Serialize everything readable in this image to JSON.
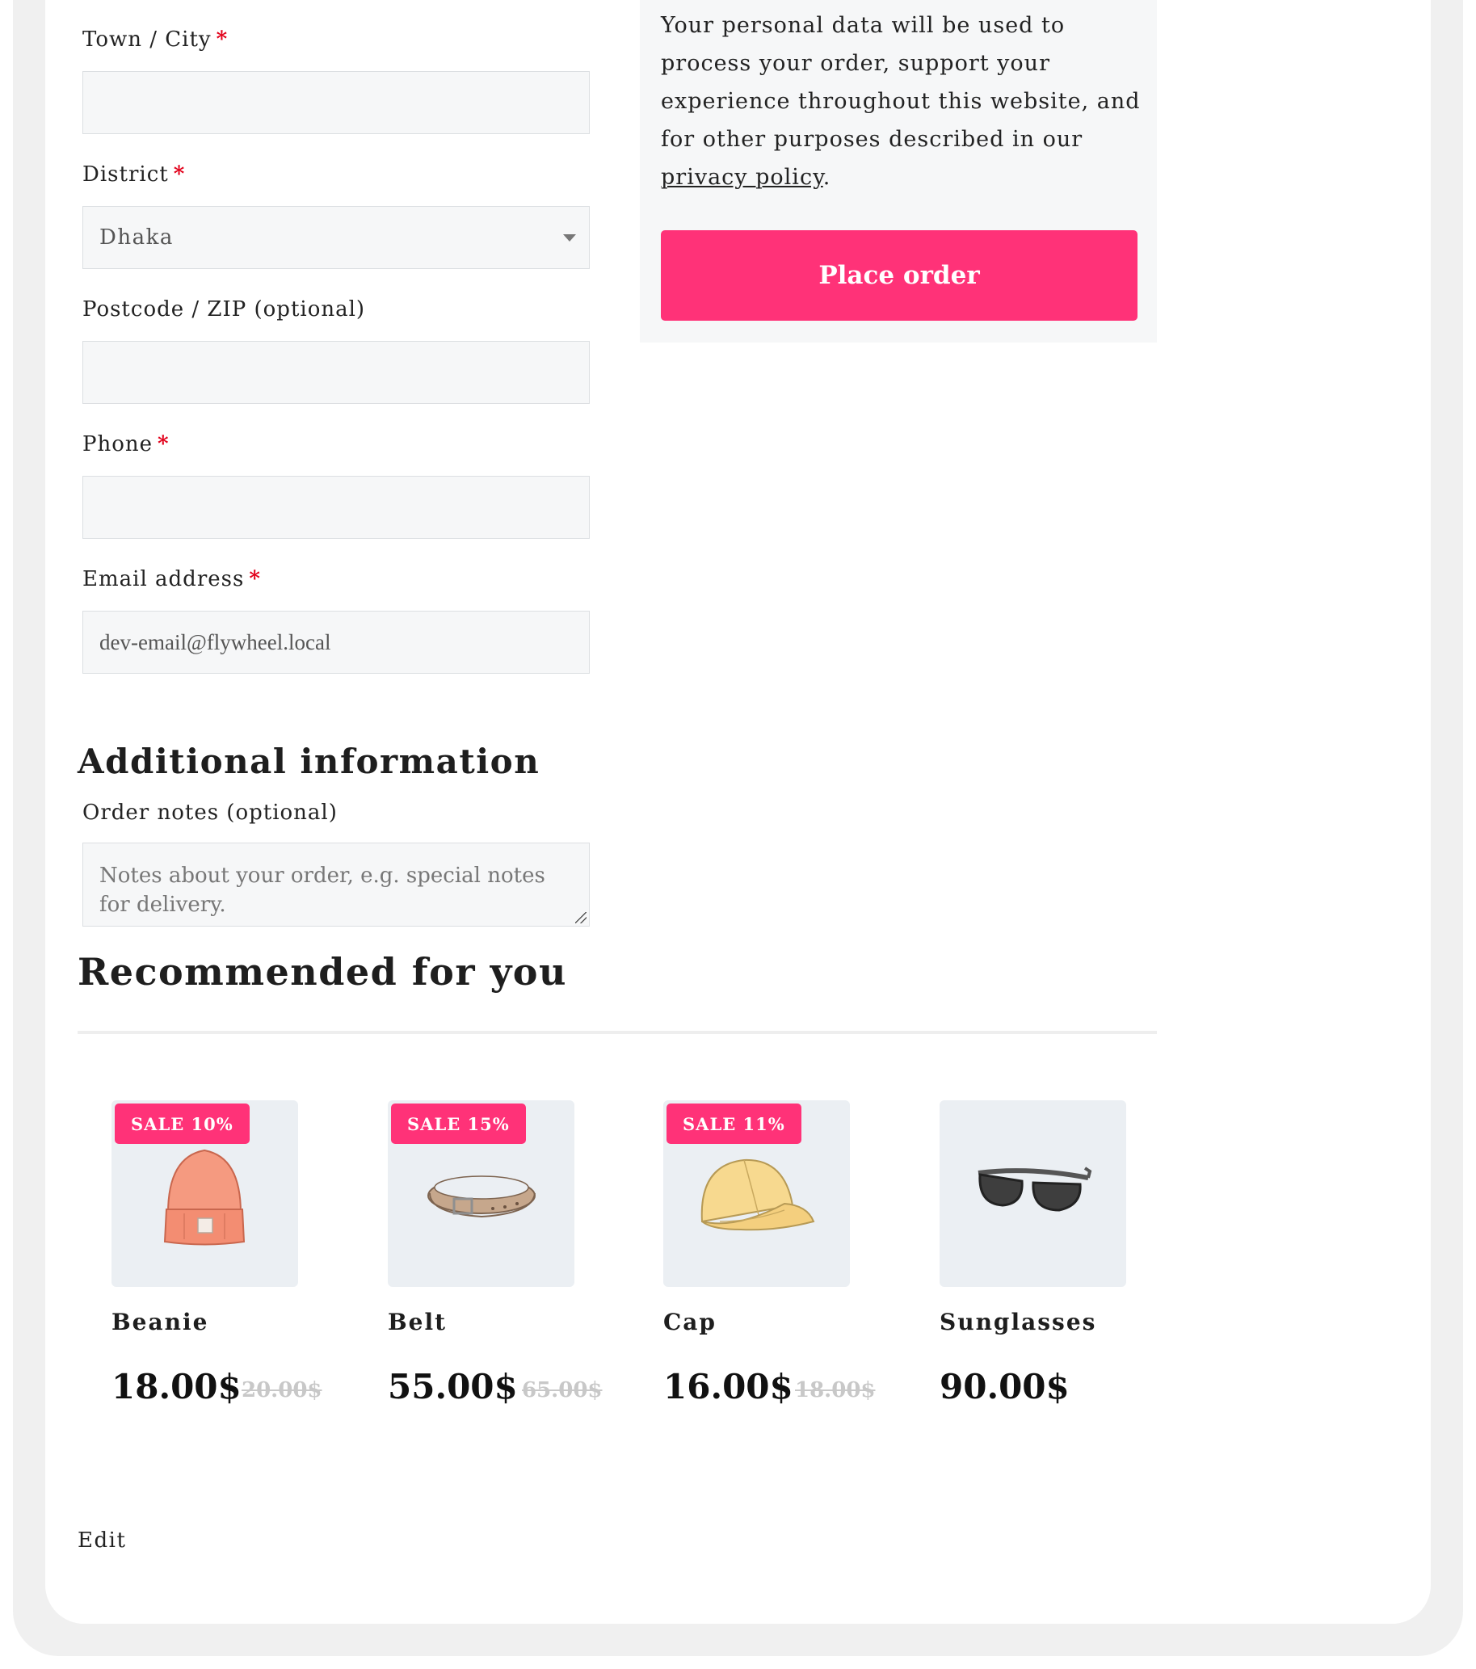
{
  "billing": {
    "town_label": "Town / City",
    "town_value": "",
    "district_label": "District",
    "district_value": "Dhaka",
    "postcode_label": "Postcode / ZIP (optional)",
    "postcode_value": "",
    "phone_label": "Phone",
    "phone_value": "",
    "email_label": "Email address",
    "email_value": "dev-email@flywheel.local",
    "required_mark": "*"
  },
  "order_review": {
    "privacy_text_before": "Your personal data will be used to process your order, support your experience throughout this website, and for other purposes described in our ",
    "privacy_link": "privacy policy",
    "privacy_text_after": ".",
    "place_order_label": "Place order"
  },
  "additional": {
    "heading": "Additional information",
    "notes_label": "Order notes (optional)",
    "notes_placeholder": "Notes about your order, e.g. special notes for delivery."
  },
  "recommended": {
    "heading": "Recommended for you",
    "products": [
      {
        "name": "Beanie",
        "price": "18.00$",
        "old_price": "20.00$",
        "badge": "SALE 10%",
        "icon": "beanie-icon"
      },
      {
        "name": "Belt",
        "price": "55.00$",
        "old_price": "65.00$",
        "badge": "SALE 15%",
        "icon": "belt-icon"
      },
      {
        "name": "Cap",
        "price": "16.00$",
        "old_price": "18.00$",
        "badge": "SALE 11%",
        "icon": "cap-icon"
      },
      {
        "name": "Sunglasses",
        "price": "90.00$",
        "old_price": "",
        "badge": "",
        "icon": "sunglasses-icon"
      }
    ]
  },
  "footer": {
    "edit_label": "Edit"
  },
  "colors": {
    "accent": "#ff3278",
    "required": "#e2001a",
    "field_bg": "#f6f7f8"
  }
}
